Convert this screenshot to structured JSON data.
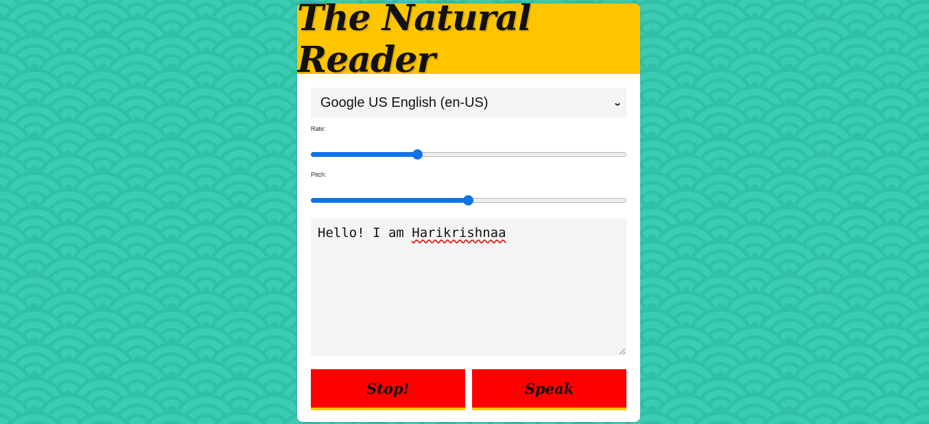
{
  "app": {
    "title": "The Natural Reader"
  },
  "voice_select": {
    "selected": "Google US English (en-US)"
  },
  "rate": {
    "label": "Rate:",
    "value_fraction": 0.34
  },
  "pitch": {
    "label": "Pitch:",
    "value_fraction": 0.5
  },
  "text_input": {
    "value_prefix": "Hello! I am ",
    "value_misspelled": "Harikrishnaa"
  },
  "buttons": {
    "stop_label": "Stop!",
    "speak_label": "Speak"
  },
  "colors": {
    "background": "#3cccb4",
    "header": "#ffc600",
    "button": "#ff0000",
    "slider_accent": "#0f75e6"
  }
}
